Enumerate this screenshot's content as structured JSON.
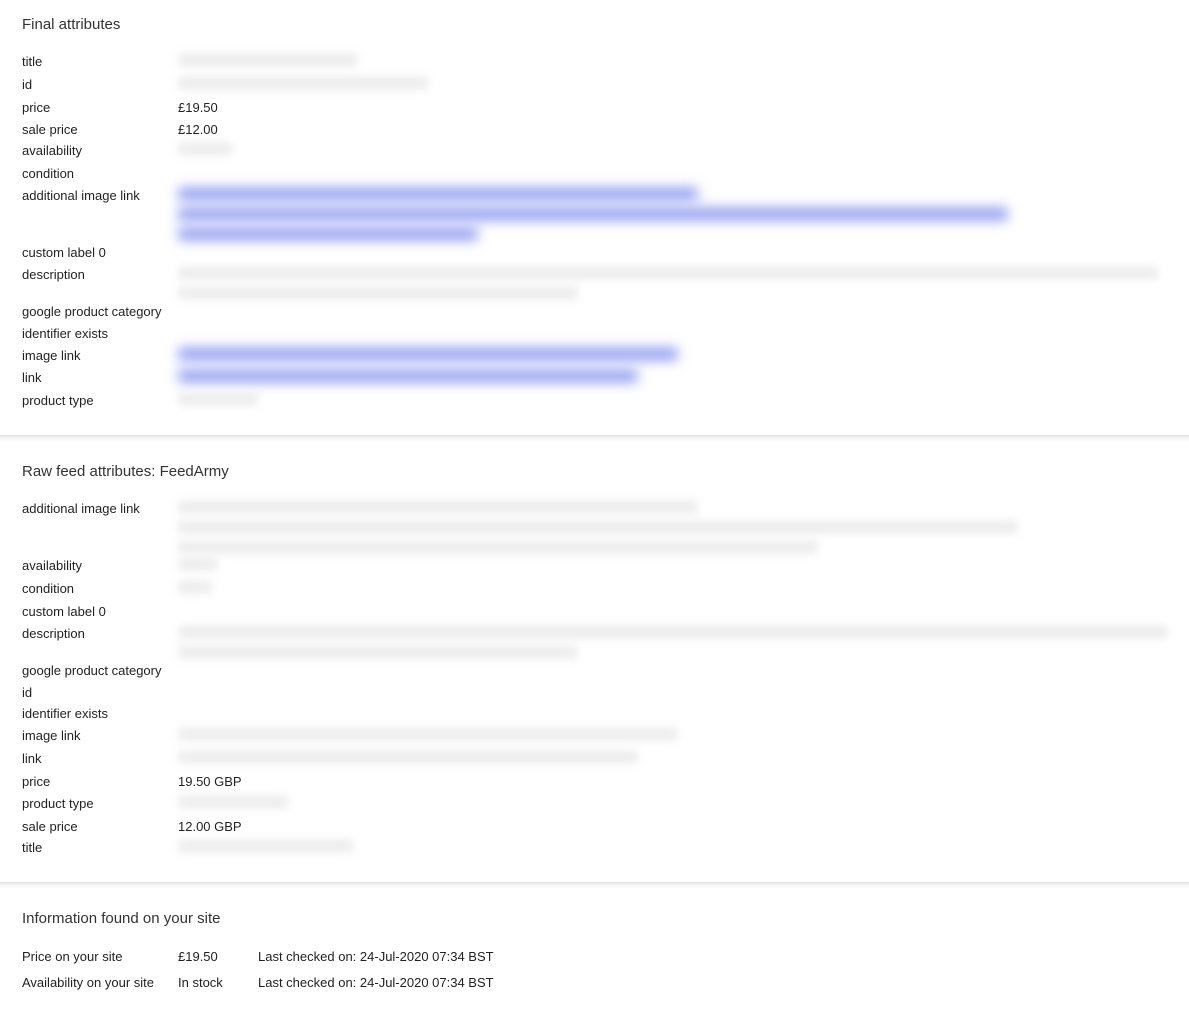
{
  "final": {
    "title": "Final attributes",
    "rows": {
      "title": "title",
      "id": "id",
      "price": {
        "label": "price",
        "value": "£19.50"
      },
      "sale_price": {
        "label": "sale price",
        "value": "£12.00"
      },
      "availability": "availability",
      "condition": "condition",
      "additional_image_link": "additional image link",
      "custom_label_0": "custom label 0",
      "description": "description",
      "google_product_category": "google product category",
      "identifier_exists": "identifier exists",
      "image_link": "image link",
      "link": "link",
      "product_type": "product type"
    }
  },
  "raw": {
    "title": "Raw feed attributes: FeedArmy",
    "rows": {
      "additional_image_link": "additional image link",
      "availability": "availability",
      "condition": "condition",
      "custom_label_0": "custom label 0",
      "description": "description",
      "google_product_category": "google product category",
      "id": "id",
      "identifier_exists": "identifier exists",
      "image_link": "image link",
      "link": "link",
      "price": {
        "label": "price",
        "value": "19.50 GBP"
      },
      "product_type": "product type",
      "sale_price": {
        "label": "sale price",
        "value": "12.00 GBP"
      },
      "title": "title"
    }
  },
  "site": {
    "title": "Information found on your site",
    "price": {
      "label": "Price on your site",
      "value": "£19.50",
      "checked": "Last checked on: 24-Jul-2020 07:34 BST"
    },
    "availability": {
      "label": "Availability on your site",
      "value": "In stock",
      "checked": "Last checked on: 24-Jul-2020 07:34 BST"
    }
  }
}
